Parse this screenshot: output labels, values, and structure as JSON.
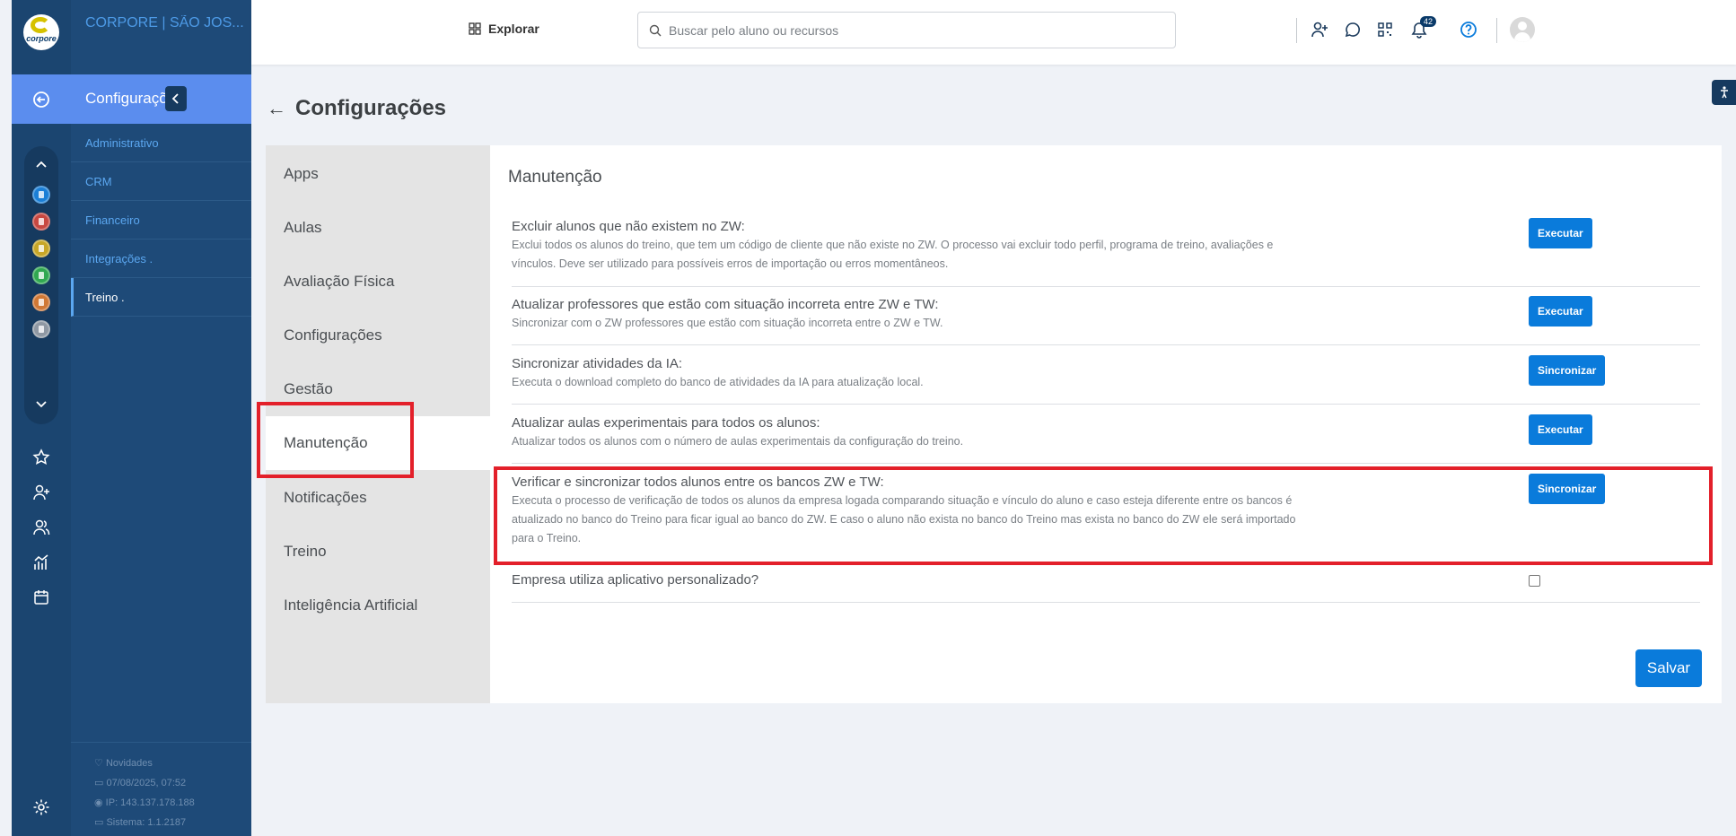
{
  "brand": {
    "logo_text": "corpore",
    "company": "CORPORE | SÃO JOS..."
  },
  "menu": {
    "active_section": "Configurações",
    "items": [
      {
        "label": "Administrativo",
        "active": false
      },
      {
        "label": "CRM",
        "active": false
      },
      {
        "label": "Financeiro",
        "active": false
      },
      {
        "label": "Integrações .",
        "active": false
      },
      {
        "label": "Treino .",
        "active": true
      }
    ],
    "footer": {
      "news": "Novidades",
      "date": "07/08/2025, 07:52",
      "ip": "IP: 143.137.178.188",
      "system": "Sistema: 1.1.2187"
    }
  },
  "topbar": {
    "explore_label": "Explorar",
    "search_placeholder": "Buscar pelo aluno ou recursos",
    "notifications_count": "42"
  },
  "page": {
    "title": "Configurações"
  },
  "tabs": [
    {
      "label": "Apps"
    },
    {
      "label": "Aulas"
    },
    {
      "label": "Avaliação Física"
    },
    {
      "label": "Configurações"
    },
    {
      "label": "Gestão"
    },
    {
      "label": "Manutenção",
      "active": true
    },
    {
      "label": "Notificações"
    },
    {
      "label": "Treino"
    },
    {
      "label": "Inteligência Artificial"
    }
  ],
  "panel": {
    "title": "Manutenção",
    "rows": [
      {
        "title": "Excluir alunos que não existem no ZW:",
        "description": "Exclui todos os alunos do treino, que tem um código de cliente que não existe no ZW. O processo vai excluir todo perfil, programa de treino, avaliações e vínculos. Deve ser utilizado para possíveis erros de importação ou erros momentâneos.",
        "button": "Executar"
      },
      {
        "title": "Atualizar professores que estão com situação incorreta entre ZW e TW:",
        "description": "Sincronizar com o ZW professores que estão com situação incorreta entre o ZW e TW.",
        "button": "Executar"
      },
      {
        "title": "Sincronizar atividades da IA:",
        "description": "Executa o download completo do banco de atividades da IA para atualização local.",
        "button": "Sincronizar"
      },
      {
        "title": "Atualizar aulas experimentais para todos os alunos:",
        "description": "Atualizar todos os alunos com o número de aulas experimentais da configuração do treino.",
        "button": "Executar"
      },
      {
        "title": "Verificar e sincronizar todos alunos entre os bancos ZW e TW:",
        "description": "Executa o processo de verificação de todos os alunos da empresa logada comparando situação e vínculo do aluno e caso esteja diferente entre os bancos é atualizado no banco do Treino para ficar igual ao banco do ZW. E caso o aluno não exista no banco do Treino mas exista no banco do ZW ele será importado para o Treino.",
        "button": "Sincronizar"
      }
    ],
    "checkbox_row": {
      "label": "Empresa utiliza aplicativo personalizado?",
      "checked": false
    },
    "save_label": "Salvar"
  },
  "colors": {
    "primary": "#0a7bdb",
    "sidebar": "#1e4a78",
    "rail": "#1b4570",
    "highlight": "#e3202a"
  }
}
